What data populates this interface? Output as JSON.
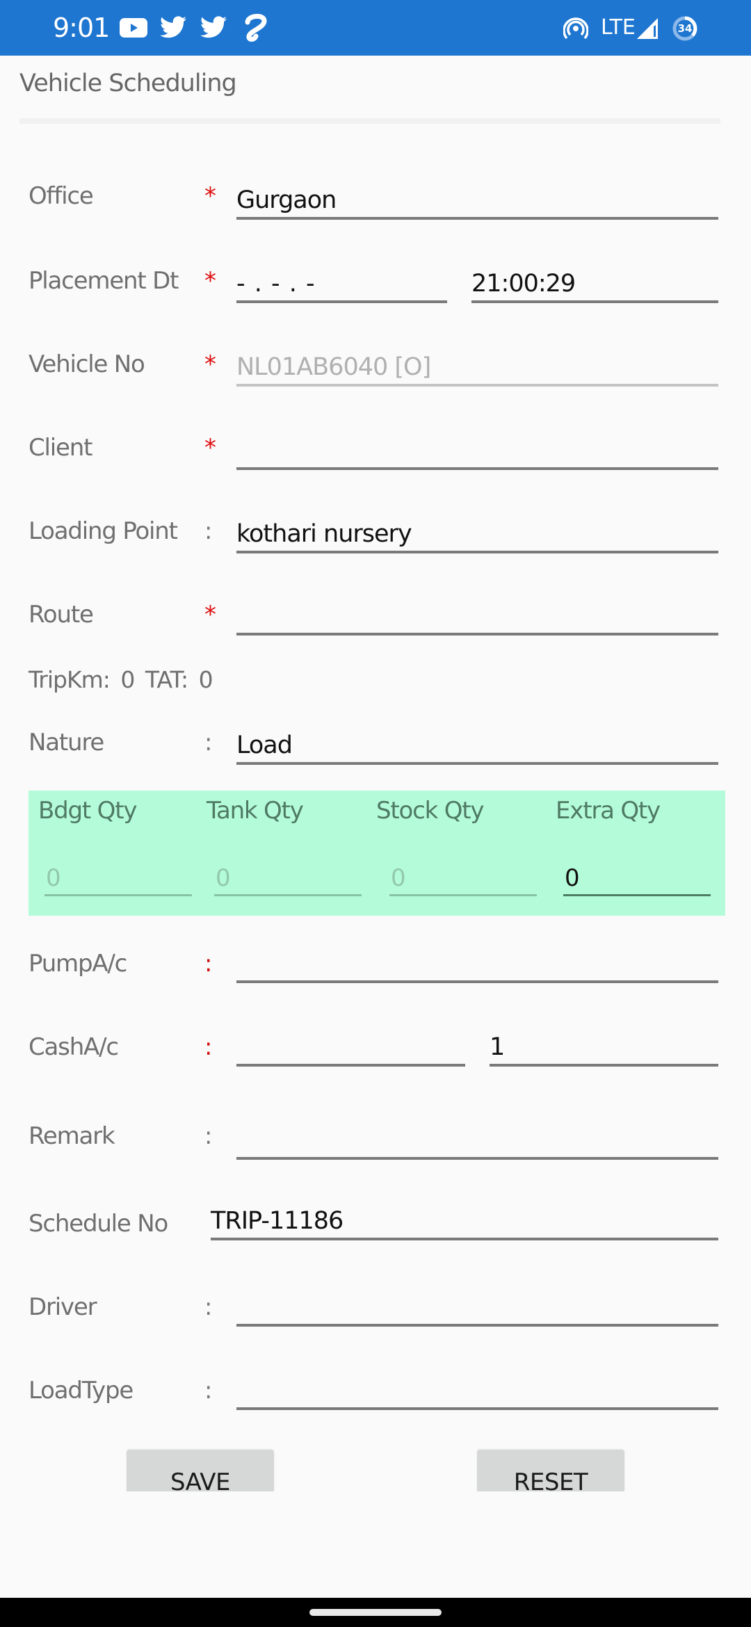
{
  "status_bar": {
    "time": "9:01",
    "notification_icons": [
      "youtube-icon",
      "twitter-icon",
      "twitter-icon",
      "airtel-icon"
    ],
    "network_type": "LTE",
    "battery_level": "34",
    "system_icons": [
      "hotspot-icon",
      "signal-icon",
      "battery-icon"
    ]
  },
  "header": {
    "title": "Vehicle Scheduling"
  },
  "form": {
    "office": {
      "label": "Office",
      "marker": "*",
      "value": "Gurgaon"
    },
    "placement_dt": {
      "label": "Placement Dt",
      "marker": "*",
      "date_value": "- . - . -",
      "time_value": "21:00:29"
    },
    "vehicle_no": {
      "label": "Vehicle No",
      "marker": "*",
      "value": "NL01AB6040 [O]"
    },
    "client": {
      "label": "Client",
      "marker": "*",
      "value": ""
    },
    "loading_point": {
      "label": "Loading Point",
      "marker": ":",
      "value": "kothari nursery"
    },
    "route": {
      "label": "Route",
      "marker": "*",
      "value": ""
    },
    "trip_info": {
      "tripkm_label": "TripKm:",
      "tripkm_value": "0",
      "tat_label": "TAT:",
      "tat_value": "0"
    },
    "nature": {
      "label": "Nature",
      "marker": ":",
      "value": "Load"
    },
    "quantities": {
      "accent_color": "#b4fcd9",
      "columns": [
        {
          "label": "Bdgt Qty",
          "value": "0",
          "enabled": false
        },
        {
          "label": "Tank Qty",
          "value": "0",
          "enabled": false
        },
        {
          "label": "Stock Qty",
          "value": "0",
          "enabled": false
        },
        {
          "label": "Extra Qty",
          "value": "0",
          "enabled": true
        }
      ]
    },
    "pump_ac": {
      "label": "PumpA/c",
      "marker": ":",
      "value": ""
    },
    "cash_ac": {
      "label": "CashA/c",
      "marker": ":",
      "value": "",
      "amount_value": "1"
    },
    "remark": {
      "label": "Remark",
      "marker": ":",
      "value": ""
    },
    "schedule_no": {
      "label": "Schedule No",
      "value": "TRIP-11186"
    },
    "driver": {
      "label": "Driver",
      "marker": ":",
      "value": ""
    },
    "load_type": {
      "label": "LoadType",
      "marker": ":",
      "value": ""
    }
  },
  "actions": {
    "save_label": "SAVE",
    "reset_label": "RESET"
  },
  "colors": {
    "status_bar": "#1e76d0",
    "required_marker": "#e01010"
  }
}
